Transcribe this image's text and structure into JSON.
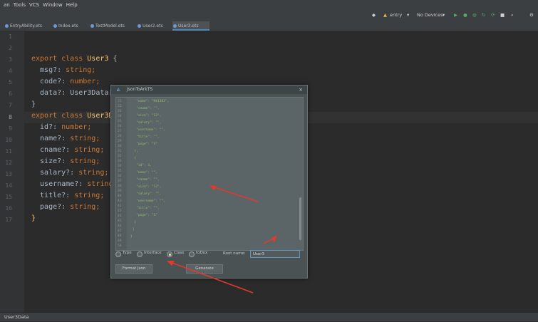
{
  "menu": [
    "an",
    "Tools",
    "VCS",
    "Window",
    "Help"
  ],
  "toolbar": {
    "module": "entry",
    "device": "No Devices"
  },
  "tabs": [
    "EntryAbility.ets",
    "Index.ets",
    "TestModel.ets",
    "User2.ets",
    "User3.ets"
  ],
  "gutter_lines": [
    "1",
    "2",
    "3",
    "4",
    "5",
    "6",
    "7",
    "8",
    "9",
    "10",
    "11",
    "12",
    "13",
    "14",
    "15",
    "16",
    "17"
  ],
  "code": {
    "l3_kw": "export class",
    "l3_name": "User3",
    "l3_brace": " {",
    "l4_prop": "  msg?:",
    "l4_type": " string;",
    "l5_prop": "  code?:",
    "l5_type": " number;",
    "l6_prop": "  data?:",
    "l6_type": " User3Data[",
    "l7": "}",
    "l8_kw": "export class",
    "l8_name": "User3D",
    "l9_prop": "  id?:",
    "l9_type": " number;",
    "l10_prop": "  name?:",
    "l10_type": " string;",
    "l11_prop": "  cname?:",
    "l11_type": " string;",
    "l12_prop": "  size?:",
    "l12_type": " string;",
    "l13_prop": "  salary?:",
    "l13_type": " string;",
    "l14_prop": "  username?:",
    "l14_type": " string",
    "l15_prop": "  title?:",
    "l15_type": " string;",
    "l16_prop": "  page?:",
    "l16_type": " string;",
    "l17": "}"
  },
  "dialog": {
    "title": "JsonToArkTS",
    "close": "×",
    "json_line_numbers": [
      "21",
      "22",
      "23",
      "24",
      "25",
      "26",
      "27",
      "28",
      "29",
      "30",
      "31",
      "32",
      "33",
      "34",
      "35",
      "36",
      "37",
      "38",
      "39",
      "40",
      "41",
      "42",
      "43",
      "44",
      "45",
      "46",
      "47",
      "48",
      "49",
      "50"
    ],
    "json_lines": [
      "   \"name\": \"Kk1303\",",
      "   \"cname\": \"\",",
      "   \"size\": \"12\",",
      "   \"salary\": \"\",",
      "   \"username\": \"\",",
      "   \"title\": \"\",",
      "   \"page\": \"4\"",
      "  },",
      "  {",
      "   \"id\": 3,",
      "   \"name\": \"\",",
      "   \"cname\": \"\",",
      "   \"size\": \"12\",",
      "   \"salary\": \"\",",
      "   \"username\": \"\",",
      "   \"title\": \"\",",
      "   \"page\": \"5\"",
      "  }",
      " ]",
      "}"
    ],
    "options": [
      "Type",
      "Interface",
      "Class",
      "toDox"
    ],
    "root_label": "Root name:",
    "root_value": "User3",
    "format_label": "Format Json",
    "generate_label": "Generate"
  },
  "status": {
    "text": "User3Data"
  },
  "colors": {
    "editor_bg": "#2b2b2b",
    "keyword": "#cc7832",
    "class_name": "#ffc66d",
    "annotation_arrow": "#e23a2e"
  }
}
